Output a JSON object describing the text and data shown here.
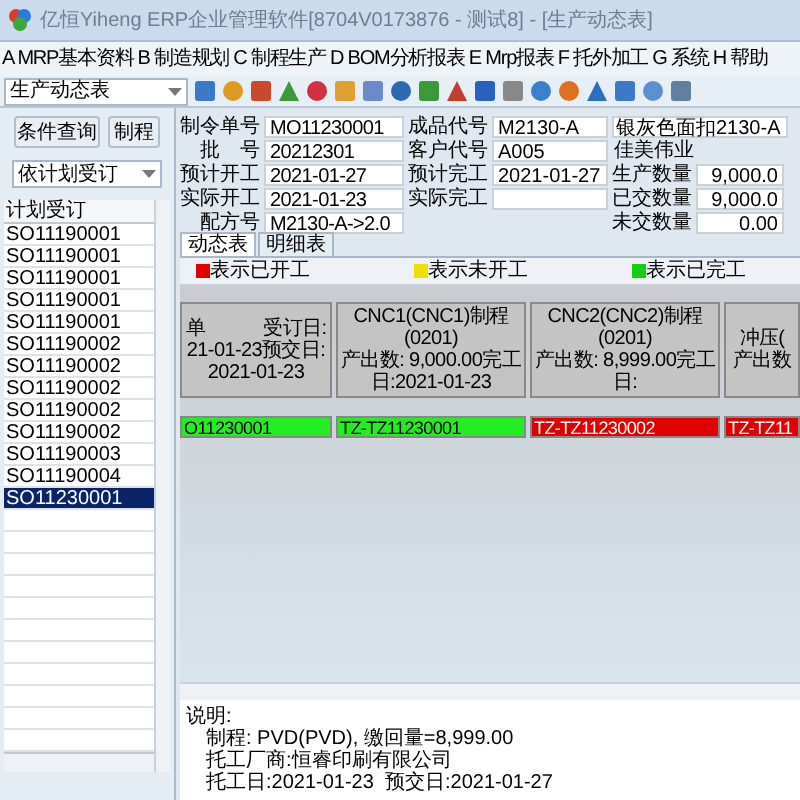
{
  "window": {
    "title": "亿恒Yiheng ERP企业管理软件[8704V0173876 - 测试8] - [生产动态表]"
  },
  "menu": [
    "A MRP基本资料",
    "B 制造规划",
    "C 制程生产",
    "D BOM分析报表",
    "E Mrp报表",
    "F 托外加工",
    "G 系统",
    "H 帮助"
  ],
  "toolbar": {
    "dropdown": "生产动态表"
  },
  "sidebar": {
    "buttons": [
      "条件查询",
      "制程"
    ],
    "filter": "依计划受订",
    "column": "计划受订",
    "rows": [
      {
        "text": "SO11190001",
        "selected": false
      },
      {
        "text": "SO11190001",
        "selected": false
      },
      {
        "text": "SO11190001",
        "selected": false
      },
      {
        "text": "SO11190001",
        "selected": false
      },
      {
        "text": "SO11190001",
        "selected": false
      },
      {
        "text": "SO11190002",
        "selected": false
      },
      {
        "text": "SO11190002",
        "selected": false
      },
      {
        "text": "SO11190002",
        "selected": false
      },
      {
        "text": "SO11190002",
        "selected": false
      },
      {
        "text": "SO11190002",
        "selected": false
      },
      {
        "text": "SO11190003",
        "selected": false
      },
      {
        "text": "SO11190004",
        "selected": false
      },
      {
        "text": "SO11230001",
        "selected": true
      }
    ]
  },
  "form": {
    "col1": [
      {
        "label": "制令单号",
        "value": "MO11230001"
      },
      {
        "label": "批　号",
        "value": "20212301"
      },
      {
        "label": "预计开工",
        "value": "2021-01-27"
      },
      {
        "label": "实际开工",
        "value": "2021-01-23"
      },
      {
        "label": "配方号",
        "value": "M2130-A->2.0"
      }
    ],
    "col2": [
      {
        "label": "成品代号",
        "value": "M2130-A"
      },
      {
        "label": "客户代号",
        "value": "A005"
      },
      {
        "label": "预计完工",
        "value": "2021-01-27"
      },
      {
        "label": "实际完工"
      }
    ],
    "product_name": "银灰色面扣2130-A",
    "customer_name": "佳美伟业",
    "quantities": [
      {
        "label": "生产数量",
        "value": "9,000.0"
      },
      {
        "label": "已交数量",
        "value": "9,000.0"
      },
      {
        "label": "未交数量",
        "value": "0.00"
      }
    ]
  },
  "tabs": [
    {
      "label": "动态表",
      "selected": true
    },
    {
      "label": "明细表",
      "selected": false
    }
  ],
  "legend": [
    {
      "label": "表示已开工",
      "color": "#e00000"
    },
    {
      "label": "表示未开工",
      "color": "#f0e000"
    },
    {
      "label": "表示已完工",
      "color": "#10d010"
    }
  ],
  "stages": [
    {
      "lines": [
        "单　　　受订日:",
        "21-01-23预交日:",
        "2021-01-23"
      ],
      "order": "O11230001",
      "color": "#22ee22"
    },
    {
      "lines": [
        "CNC1(CNC1)制程 (0201)",
        "产出数: 9,000.00完工",
        "日:2021-01-23"
      ],
      "order": "TZ-TZ11230001",
      "color": "#22ee22"
    },
    {
      "lines": [
        "CNC2(CNC2)制程 (0201)",
        "产出数: 8,999.00完工",
        "日:"
      ],
      "order": "TZ-TZ11230002",
      "color": "#e00000"
    },
    {
      "lines": [
        "冲压(",
        "产出数"
      ],
      "order": "TZ-TZ11",
      "color": "#e00000"
    }
  ],
  "description": {
    "title": "说明:",
    "lines": [
      "制程: PVD(PVD), 缴回量=8,999.00",
      "托工厂商:恒睿印刷有限公司",
      "托工日:2021-01-23  预交日:2021-01-27"
    ]
  }
}
